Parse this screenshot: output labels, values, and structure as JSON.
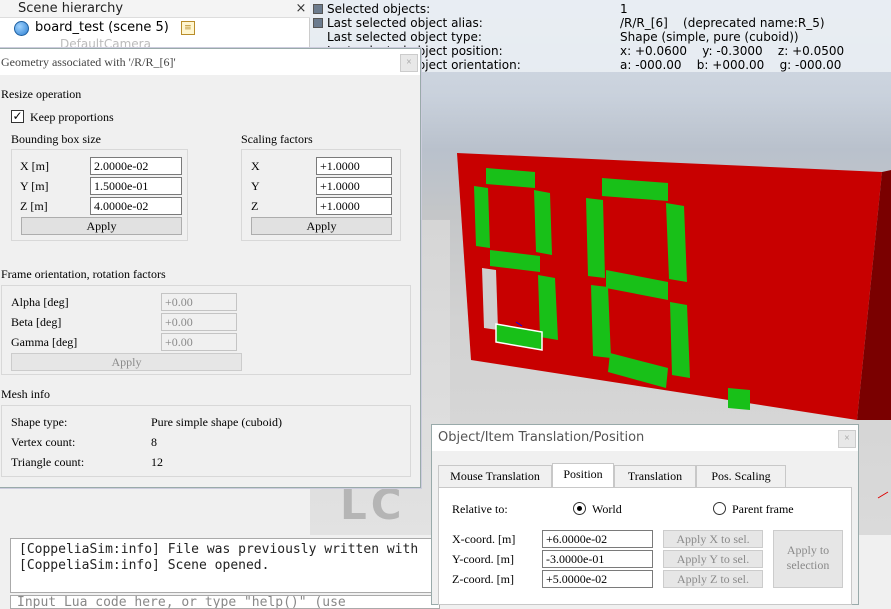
{
  "hierarchy": {
    "title": "Scene hierarchy",
    "close": "×",
    "scene_item": "board_test (scene 5)",
    "partial_item": "DefaultCamera"
  },
  "info": {
    "rows": [
      {
        "label": "Selected objects:",
        "value": "1"
      },
      {
        "label": "Last selected object alias:",
        "value": "/R/R_[6]    (deprecated name:R_5)"
      },
      {
        "label": "Last selected object type:",
        "value": "Shape (simple, pure (cuboid))"
      },
      {
        "label": "Last selected object position:",
        "value": "x: +0.0600    y: -0.3000    z: +0.0500"
      },
      {
        "label": "Last selected object orientation:",
        "value": "a: -000.00    b: +000.00    g: -000.00"
      }
    ]
  },
  "floor_text": "LC",
  "console": {
    "lines": [
      "[CoppeliaSim:info] File was previously written with",
      "[CoppeliaSim:info] Scene opened."
    ],
    "input_placeholder": "Input Lua code here, or type \"help()\" (use"
  },
  "geometry": {
    "title": "Geometry associated with '/R/R_[6]'",
    "resize_heading": "Resize operation",
    "keep_proportions": "Keep proportions",
    "keep_checked": "✓",
    "bbox_heading": "Bounding box size",
    "scaling_heading": "Scaling factors",
    "bbox": [
      {
        "label": "X [m]",
        "value": "2.0000e-02"
      },
      {
        "label": "Y [m]",
        "value": "1.5000e-01"
      },
      {
        "label": "Z [m]",
        "value": "4.0000e-02"
      }
    ],
    "scale": [
      {
        "label": "X",
        "value": "+1.0000"
      },
      {
        "label": "Y",
        "value": "+1.0000"
      },
      {
        "label": "Z",
        "value": "+1.0000"
      }
    ],
    "apply": "Apply",
    "orient_heading": "Frame orientation, rotation factors",
    "orient": [
      {
        "label": "Alpha [deg]",
        "value": "+0.00"
      },
      {
        "label": "Beta [deg]",
        "value": "+0.00"
      },
      {
        "label": "Gamma [deg]",
        "value": "+0.00"
      }
    ],
    "mesh_heading": "Mesh info",
    "mesh": [
      {
        "label": "Shape type:",
        "value": "Pure simple shape (cuboid)"
      },
      {
        "label": "Vertex count:",
        "value": "8"
      },
      {
        "label": "Triangle count:",
        "value": "12"
      }
    ]
  },
  "translation": {
    "title": "Object/Item Translation/Position",
    "tabs": [
      "Mouse Translation",
      "Position",
      "Translation",
      "Pos. Scaling"
    ],
    "relative_to": "Relative to:",
    "world": "World",
    "parent_frame": "Parent frame",
    "coords": [
      {
        "label": "X-coord. [m]",
        "value": "+6.0000e-02",
        "button": "Apply X to sel."
      },
      {
        "label": "Y-coord. [m]",
        "value": "-3.0000e-01",
        "button": "Apply Y to sel."
      },
      {
        "label": "Z-coord. [m]",
        "value": "+5.0000e-02",
        "button": "Apply Z to sel."
      }
    ],
    "apply_selection": "Apply to selection"
  },
  "colors": {
    "board": "#c00000",
    "segment": "#10c010"
  }
}
